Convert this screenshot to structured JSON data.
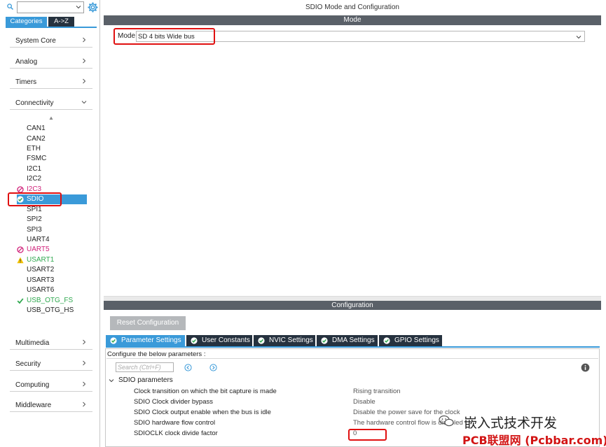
{
  "left_panel": {
    "search": {
      "value": ""
    },
    "category_tabs": [
      "Categories",
      "A->Z"
    ],
    "categories_top": [
      "System Core",
      "Analog",
      "Timers",
      "Connectivity"
    ],
    "connectivity_items": [
      {
        "label": "CAN1",
        "status": "none"
      },
      {
        "label": "CAN2",
        "status": "none"
      },
      {
        "label": "ETH",
        "status": "none"
      },
      {
        "label": "FSMC",
        "status": "none"
      },
      {
        "label": "I2C1",
        "status": "none"
      },
      {
        "label": "I2C2",
        "status": "none"
      },
      {
        "label": "I2C3",
        "status": "disabled"
      },
      {
        "label": "SDIO",
        "status": "selected-ok"
      },
      {
        "label": "SPI1",
        "status": "none"
      },
      {
        "label": "SPI2",
        "status": "none"
      },
      {
        "label": "SPI3",
        "status": "none"
      },
      {
        "label": "UART4",
        "status": "none"
      },
      {
        "label": "UART5",
        "status": "disabled"
      },
      {
        "label": "USART1",
        "status": "warning"
      },
      {
        "label": "USART2",
        "status": "none"
      },
      {
        "label": "USART3",
        "status": "none"
      },
      {
        "label": "USART6",
        "status": "none"
      },
      {
        "label": "USB_OTG_FS",
        "status": "ok"
      },
      {
        "label": "USB_OTG_HS",
        "status": "none"
      }
    ],
    "categories_bottom": [
      "Multimedia",
      "Security",
      "Computing",
      "Middleware"
    ]
  },
  "page_title": "SDIO Mode and Configuration",
  "mode": {
    "header": "Mode",
    "label": "Mode",
    "value": "SD 4 bits Wide bus"
  },
  "configuration": {
    "header": "Configuration",
    "reset_label": "Reset Configuration",
    "tabs": [
      {
        "label": "Parameter Settings",
        "active": true
      },
      {
        "label": "User Constants",
        "active": false
      },
      {
        "label": "NVIC Settings",
        "active": false
      },
      {
        "label": "DMA Settings",
        "active": false
      },
      {
        "label": "GPIO Settings",
        "active": false
      }
    ],
    "hint": "Configure the below parameters :",
    "search_placeholder": "Search (Ctrl+F)",
    "group": "SDIO parameters",
    "parameters": [
      {
        "name": "Clock transition on which the bit capture is made",
        "value": "Rising transition"
      },
      {
        "name": "SDIO Clock divider bypass",
        "value": "Disable"
      },
      {
        "name": "SDIO Clock output enable when the bus is idle",
        "value": "Disable the power save for the clock"
      },
      {
        "name": "SDIO hardware flow control",
        "value": "The hardware control flow is disabled"
      },
      {
        "name": "SDIOCLK clock divide factor",
        "value": "0"
      }
    ]
  },
  "watermark": {
    "line1": "嵌入式技术开发",
    "line2": "PCB联盟网 (Pcbbar.com)"
  },
  "colors": {
    "accent": "#3a9ad9",
    "dark_tab": "#26323f",
    "header_gray": "#5a6068",
    "highlight_red": "#e01010",
    "disabled_pink": "#d0227a",
    "ok_green": "#2fa84f",
    "warning_yellow": "#f2c200"
  }
}
